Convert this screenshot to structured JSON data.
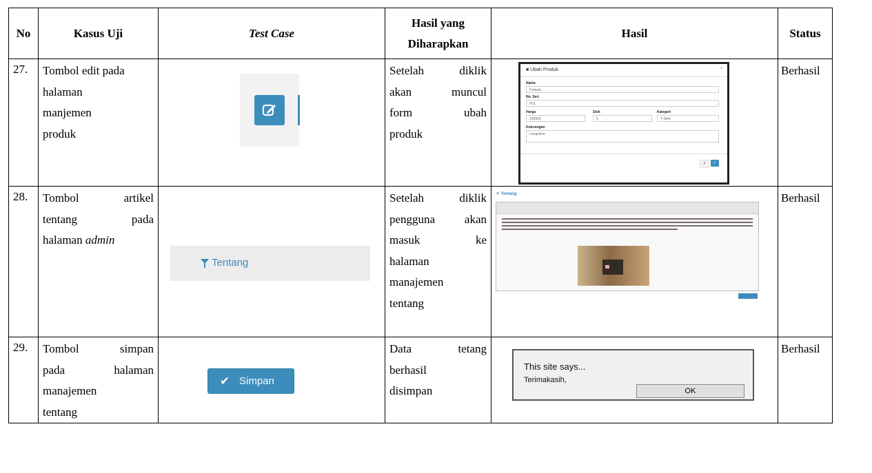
{
  "headers": {
    "no": "No",
    "kasus_uji": "Kasus Uji",
    "test_case": "Test Case",
    "hasil_diharapkan_1": "Hasil yang",
    "hasil_diharapkan_2": "Diharapkan",
    "hasil": "Hasil",
    "status": "Status"
  },
  "rows": [
    {
      "no": "27.",
      "kasus_uji": [
        "Tombol edit pada",
        "halaman",
        "manjemen",
        "produk"
      ],
      "expected": [
        [
          "Setelah",
          "diklik"
        ],
        [
          "akan",
          "muncul"
        ],
        [
          "form",
          "ubah"
        ],
        [
          "produk"
        ]
      ],
      "status": "Berhasil",
      "modal": {
        "title": "Ubah Produk",
        "close": "×",
        "nama_label": "Nama",
        "nama_value": "Fortune",
        "seri_label": "No. Seri",
        "seri_value": "F01",
        "harga_label": "Harga",
        "harga_value": "130000",
        "stok_label": "Stok",
        "stok_value": "5",
        "kategori_label": "Kategori",
        "kategori_value": "T-Shirt",
        "ket_label": "Keterangan",
        "ket_value": "Longsleve",
        "cancel_btn": "×",
        "ok_btn": "✓"
      }
    },
    {
      "no": "28.",
      "kasus_uji_line1": [
        "Tombol",
        "artikel"
      ],
      "kasus_uji_line2": [
        "tentang",
        "pada"
      ],
      "kasus_uji_line3_prefix": "halaman ",
      "kasus_uji_line3_em": "admin",
      "expected": [
        [
          "Setelah",
          "diklik"
        ],
        [
          "pengguna",
          "akan"
        ],
        [
          "masuk",
          "ke"
        ],
        [
          "halaman"
        ],
        [
          "manajemen"
        ],
        [
          "tentang"
        ]
      ],
      "status": "Berhasil",
      "test_button": "Tentang",
      "editor_title": "Tentang"
    },
    {
      "no": "29.",
      "kasus_uji": [
        [
          "Tombol",
          "simpan"
        ],
        [
          "pada",
          "halaman"
        ],
        [
          "manajemen"
        ],
        [
          "tentang"
        ]
      ],
      "expected": [
        [
          "Data",
          "tetang"
        ],
        [
          "berhasil"
        ],
        [
          "disimpan"
        ]
      ],
      "status": "Berhasil",
      "test_button": "Simpan",
      "dialog": {
        "title": "This site says...",
        "message": "Terimakasih,",
        "ok": "OK"
      }
    }
  ],
  "colors": {
    "accent": "#3c8dbc",
    "border": "#000000"
  }
}
